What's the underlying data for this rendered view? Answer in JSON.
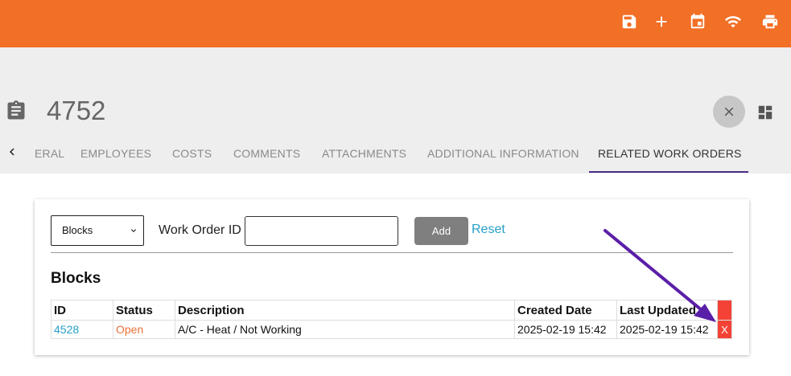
{
  "header": {
    "icons": [
      "save-icon",
      "plus-icon",
      "calendar-icon",
      "wifi-icon",
      "print-icon"
    ],
    "accent_color": "#f26f26"
  },
  "record": {
    "title": "4752",
    "icon": "clipboard-icon"
  },
  "tabs": [
    {
      "label": "ERAL"
    },
    {
      "label": "EMPLOYEES"
    },
    {
      "label": "COSTS"
    },
    {
      "label": "COMMENTS"
    },
    {
      "label": "ATTACHMENTS"
    },
    {
      "label": "ADDITIONAL INFORMATION"
    },
    {
      "label": "RELATED WORK ORDERS",
      "active": true
    }
  ],
  "form": {
    "relation_select": "Blocks",
    "work_order_label": "Work Order ID",
    "work_order_value": "",
    "add_label": "Add",
    "reset_label": "Reset"
  },
  "section": {
    "title": "Blocks"
  },
  "table": {
    "headers": [
      "ID",
      "Status",
      "Description",
      "Created Date",
      "Last Updated"
    ],
    "rows": [
      {
        "id": "4528",
        "status": "Open",
        "description": "A/C - Heat / Not Working",
        "created": "2025-02-19 15:42",
        "updated": "2025-02-19 15:42",
        "delete_label": "X"
      }
    ]
  },
  "colors": {
    "delete_red": "#f44336",
    "link_blue": "#26a0c8",
    "status_open": "#e8703a",
    "annotation_arrow": "#5a1fa8"
  }
}
